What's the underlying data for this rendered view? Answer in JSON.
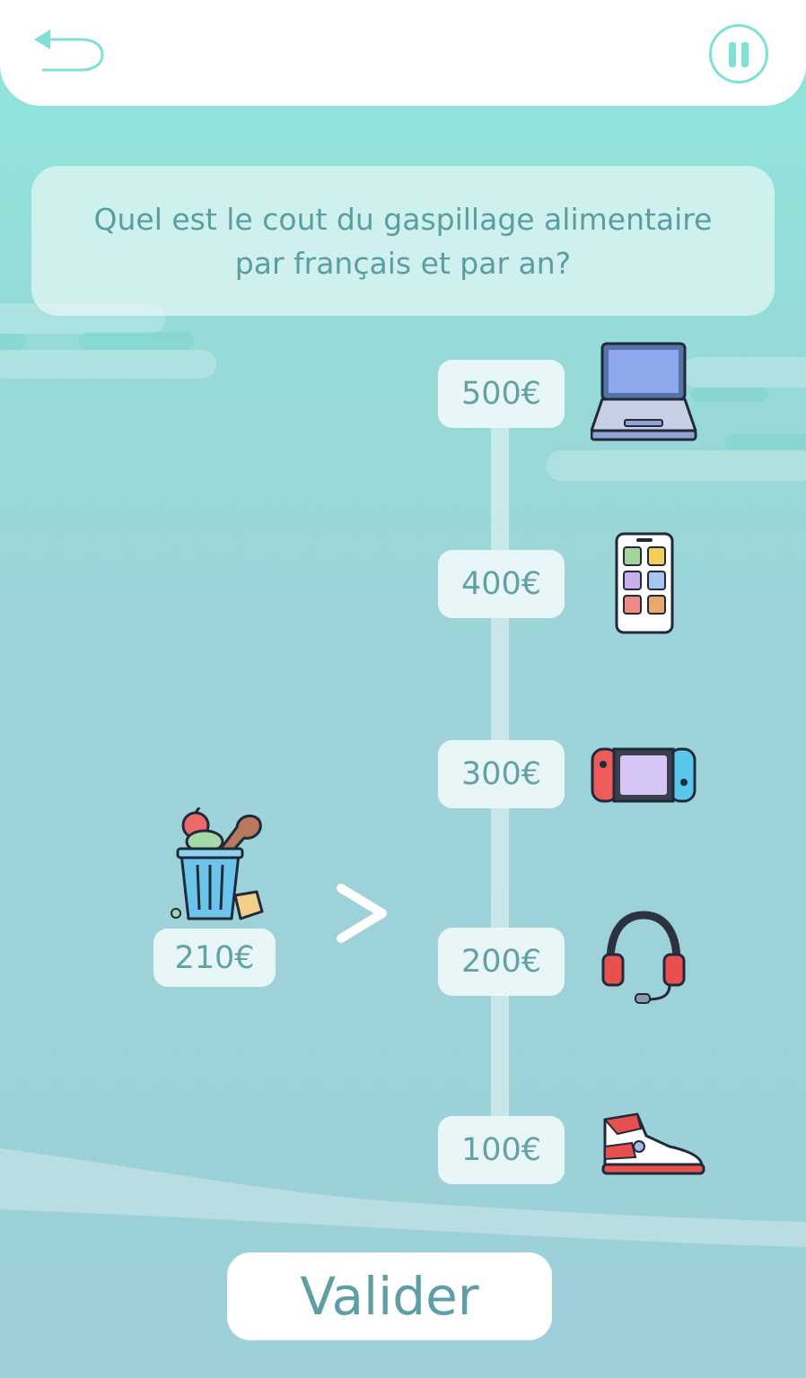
{
  "header": {
    "back_icon": "undo-arrow-icon",
    "pause_icon": "pause-icon"
  },
  "question": {
    "text": "Quel est le cout du gaspillage alimentaire par français et par an?"
  },
  "scale": {
    "ticks": [
      {
        "label": "500€",
        "icon": "laptop-icon"
      },
      {
        "label": "400€",
        "icon": "smartphone-icon"
      },
      {
        "label": "300€",
        "icon": "game-console-icon"
      },
      {
        "label": "200€",
        "icon": "headset-icon"
      },
      {
        "label": "100€",
        "icon": "sneaker-icon"
      }
    ]
  },
  "answer": {
    "value_label": "210€",
    "icon": "food-waste-bin-icon",
    "comparison_icon": "greater-than-icon"
  },
  "actions": {
    "validate_label": "Valider"
  },
  "colors": {
    "accent": "#7fe0d6",
    "text": "#5a9ea2",
    "background_top": "#8ee7dc",
    "background_bottom": "#9dd0d8"
  }
}
